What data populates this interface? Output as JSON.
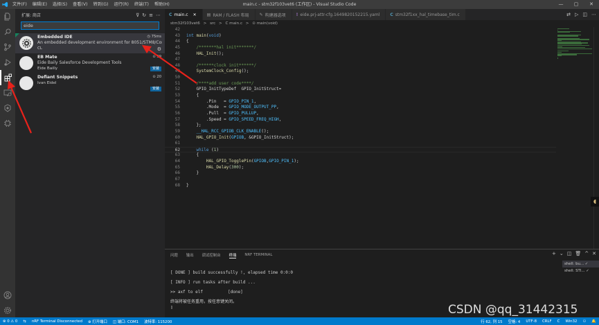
{
  "titlebar": {
    "menu": [
      "文件(F)",
      "编辑(E)",
      "选择(S)",
      "查看(V)",
      "转到(G)",
      "运行(R)",
      "终端(T)",
      "帮助(H)"
    ],
    "title": "main.c - stm32f103vet6 (工作区) - Visual Studio Code",
    "controls": [
      "—",
      "▢",
      "✕"
    ]
  },
  "sidebar": {
    "title": "扩展: 商店",
    "search_value": "eide",
    "extensions": [
      {
        "name": "Embedded IDE",
        "desc": "An embedded development environment for 8051/STM8/Cortex-M/...",
        "publisher": "CL",
        "meta": "75ms",
        "installed": true
      },
      {
        "name": "EB Mate",
        "desc": "Eide Baily Salesforce Development Tools",
        "publisher": "Eide Bailly",
        "meta": "39",
        "action": "安装"
      },
      {
        "name": "Defiant Snippets",
        "desc": "",
        "publisher": "Ivan Eidel",
        "meta": "20",
        "action": "安装"
      }
    ]
  },
  "tabs": [
    {
      "icon": "C",
      "label": "main.c",
      "color": "#519aba",
      "active": true
    },
    {
      "icon": "▤",
      "label": "RAM / FLASH 布局",
      "color": "#c5c5c5"
    },
    {
      "icon": "✎",
      "label": "构建器选项",
      "color": "#c5c5c5"
    },
    {
      "icon": "!",
      "label": "eide.prj-attr-cfg.1649820152215.yaml",
      "color": "#a074c4"
    },
    {
      "icon": "C",
      "label": "stm32f1xx_hal_timebase_tim.c",
      "color": "#519aba"
    }
  ],
  "breadcrumb": [
    "stm32f103vet6",
    ">",
    "src",
    ">",
    "C main.c",
    ">",
    "⊙ main(void)"
  ],
  "code": [
    {
      "n": "42",
      "t": ""
    },
    {
      "n": "43",
      "t": "int main(void)"
    },
    {
      "n": "44",
      "t": "{"
    },
    {
      "n": "45",
      "t": "    /*******hal init*******/"
    },
    {
      "n": "46",
      "t": "    HAL_Init();"
    },
    {
      "n": "47",
      "t": ""
    },
    {
      "n": "48",
      "t": "    /******clock init******/"
    },
    {
      "n": "49",
      "t": "    SystemClock_Config();"
    },
    {
      "n": "50",
      "t": ""
    },
    {
      "n": "51",
      "t": "    /****add user code****/"
    },
    {
      "n": "52",
      "t": "    GPIO_InitTypeDef  GPIO_InitStruct="
    },
    {
      "n": "53",
      "t": "    {"
    },
    {
      "n": "54",
      "t": "        .Pin   = GPIO_PIN_1,"
    },
    {
      "n": "55",
      "t": "        .Mode  = GPIO_MODE_OUTPUT_PP,"
    },
    {
      "n": "56",
      "t": "        .Pull  = GPIO_PULLUP,"
    },
    {
      "n": "57",
      "t": "        .Speed = GPIO_SPEED_FREQ_HIGH,"
    },
    {
      "n": "58",
      "t": "    };"
    },
    {
      "n": "59",
      "t": "    __HAL_RCC_GPIOB_CLK_ENABLE();"
    },
    {
      "n": "60",
      "t": "    HAL_GPIO_Init(GPIOB, &GPIO_InitStruct);"
    },
    {
      "n": "61",
      "t": ""
    },
    {
      "n": "62",
      "t": "    while (1)"
    },
    {
      "n": "63",
      "t": "    {"
    },
    {
      "n": "64",
      "t": "        HAL_GPIO_TogglePin(GPIOB,GPIO_PIN_1);"
    },
    {
      "n": "65",
      "t": "        HAL_Delay(300);"
    },
    {
      "n": "66",
      "t": "    }"
    },
    {
      "n": "67",
      "t": ""
    },
    {
      "n": "68",
      "t": "}"
    }
  ],
  "panel": {
    "tabs": [
      "问题",
      "输出",
      "调试控制台",
      "终端",
      "NRF TERMINAL"
    ],
    "active_tab": 3,
    "actions": [
      "+",
      "⌄",
      "◫",
      "🗑",
      "^",
      "✕"
    ],
    "terminal_lines": [
      "",
      "[ DONE ] build successfully !, elapsed time 0:0:0",
      "",
      "[ INFO ] run tasks after build ...",
      "",
      ">> axf to elf          [done]",
      "",
      "终端将被任务重用，按任意键关闭。",
      "▯"
    ],
    "terminal_list": [
      "shell: bu... ✓",
      "shell: STI... ✓"
    ]
  },
  "watermark": "CSDN @qq_31442315",
  "statusbar": {
    "left": [
      "⊗ 0 ⚠ 0",
      "⇆",
      "nRF Terminal Disconnected",
      "⊕ 打开端口",
      "◫ 端口: COM1",
      "波特率: 115200"
    ],
    "right": [
      "行 62, 列 15",
      "空格: 4",
      "UTF-8",
      "CRLF",
      "C",
      "Win32",
      "⚇",
      "🔔"
    ]
  },
  "colors": {
    "accent": "#007acc",
    "arrow": "#e8221b",
    "keyword": "#569cd6",
    "comment": "#6a9955",
    "function": "#dcdcaa",
    "macro": "#4fc1ff",
    "number": "#b5cea8"
  }
}
